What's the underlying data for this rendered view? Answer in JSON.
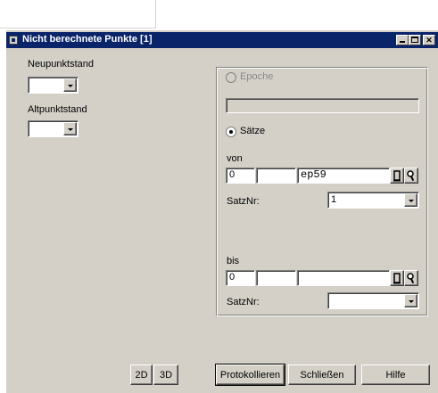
{
  "window": {
    "title": "Nicht berechnete Punkte [1]"
  },
  "left": {
    "neupunktstand_label": "Neupunktstand",
    "altpunktstand_label": "Altpunktstand"
  },
  "group": {
    "epoche_label": "Epoche",
    "saetze_label": "Sätze",
    "von": {
      "label": "von",
      "field1": "0",
      "field2": "",
      "field3": "ep59",
      "satznr_label": "SatzNr:",
      "satznr_value": "1"
    },
    "bis": {
      "label": "bis",
      "field1": "0",
      "field2": "",
      "field3": "",
      "satznr_label": "SatzNr:",
      "satznr_value": ""
    }
  },
  "buttons": {
    "btn_2d": "2D",
    "btn_3d": "3D",
    "protokollieren": "Protokollieren",
    "schliessen": "Schließen",
    "hilfe": "Hilfe"
  }
}
